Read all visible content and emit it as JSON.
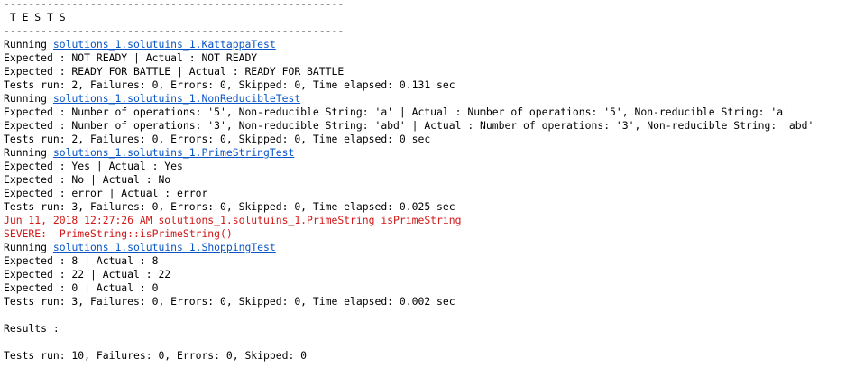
{
  "colors": {
    "text": "#000000",
    "link": "#0a56c7",
    "error": "#d11717",
    "background": "#ffffff"
  },
  "console": {
    "lines": [
      {
        "text": "-------------------------------------------------------"
      },
      {
        "text": " T E S T S"
      },
      {
        "text": "-------------------------------------------------------"
      },
      {
        "prefix": "Running ",
        "link": "solutions_1.solutuins_1.KattappaTest"
      },
      {
        "text": "Expected : NOT READY | Actual : NOT READY"
      },
      {
        "text": "Expected : READY FOR BATTLE | Actual : READY FOR BATTLE"
      },
      {
        "text": "Tests run: 2, Failures: 0, Errors: 0, Skipped: 0, Time elapsed: 0.131 sec"
      },
      {
        "prefix": "Running ",
        "link": "solutions_1.solutuins_1.NonReducibleTest"
      },
      {
        "text": "Expected : Number of operations: '5', Non-reducible String: 'a' | Actual : Number of operations: '5', Non-reducible String: 'a'"
      },
      {
        "text": "Expected : Number of operations: '3', Non-reducible String: 'abd' | Actual : Number of operations: '3', Non-reducible String: 'abd'"
      },
      {
        "text": "Tests run: 2, Failures: 0, Errors: 0, Skipped: 0, Time elapsed: 0 sec"
      },
      {
        "prefix": "Running ",
        "link": "solutions_1.solutuins_1.PrimeStringTest"
      },
      {
        "text": "Expected : Yes | Actual : Yes"
      },
      {
        "text": "Expected : No | Actual : No"
      },
      {
        "text": "Expected : error | Actual : error"
      },
      {
        "text": "Tests run: 3, Failures: 0, Errors: 0, Skipped: 0, Time elapsed: 0.025 sec"
      },
      {
        "text": "Jun 11, 2018 12:27:26 AM solutions_1.solutuins_1.PrimeString isPrimeString",
        "error": true
      },
      {
        "text": "SEVERE:  PrimeString::isPrimeString()",
        "error": true
      },
      {
        "prefix": "Running ",
        "link": "solutions_1.solutuins_1.ShoppingTest"
      },
      {
        "text": "Expected : 8 | Actual : 8"
      },
      {
        "text": "Expected : 22 | Actual : 22"
      },
      {
        "text": "Expected : 0 | Actual : 0"
      },
      {
        "text": "Tests run: 3, Failures: 0, Errors: 0, Skipped: 0, Time elapsed: 0.002 sec"
      },
      {
        "text": ""
      },
      {
        "text": "Results :"
      },
      {
        "text": ""
      },
      {
        "text": "Tests run: 10, Failures: 0, Errors: 0, Skipped: 0"
      }
    ]
  }
}
